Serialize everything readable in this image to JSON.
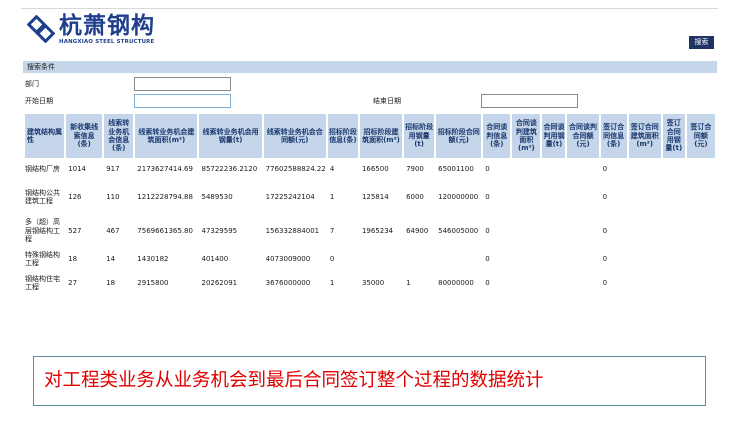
{
  "brand": {
    "name_cn": "杭萧钢构",
    "name_en": "HANGXIAO STEEL STRUCTURE"
  },
  "toolbar": {
    "search_label": "搜索"
  },
  "search_panel": {
    "title": "搜索条件",
    "department_label": "部门",
    "department_value": "",
    "start_date_label": "开始日期",
    "start_date_value": "",
    "end_date_label": "结束日期",
    "end_date_value": ""
  },
  "table": {
    "headers": [
      "建筑结构属性",
      "新收集线索信息(条)",
      "线索转业务机会信息(条)",
      "线索转业务机会建筑面积(m²)",
      "线索转业务机会用钢量(t)",
      "线索转业务机会合同额(元)",
      "招标阶段信息(条)",
      "招标阶段建筑面积(m²)",
      "招标阶段用钢量(t)",
      "招标阶段合同额(元)",
      "合同谈判信息(条)",
      "合同谈判建筑面积(m²)",
      "合同谈判用钢量(t)",
      "合同谈判合同额(元)",
      "签订合同信息(条)",
      "签订合同建筑面积(m²)",
      "签订合同用钢量(t)",
      "签订合同额(元)"
    ],
    "rows": [
      [
        "钢结构厂房",
        "1014",
        "917",
        "2173627414.69",
        "85722236.2120",
        "77602588824.22",
        "4",
        "166500",
        "7900",
        "65001100",
        "0",
        "",
        "",
        "",
        "0",
        "",
        "",
        ""
      ],
      [
        "钢结构公共建筑工程",
        "126",
        "110",
        "1212228794.88",
        "5489530",
        "17225242104",
        "1",
        "125814",
        "6000",
        "120000000",
        "0",
        "",
        "",
        "",
        "0",
        "",
        "",
        ""
      ],
      [
        "多（超）高层钢结构工程",
        "527",
        "467",
        "7569661365.80",
        "47329595",
        "156332884001",
        "7",
        "1965234",
        "64900",
        "546005000",
        "0",
        "",
        "",
        "",
        "0",
        "",
        "",
        ""
      ],
      [
        "特殊钢结构工程",
        "18",
        "14",
        "1430182",
        "401400",
        "4073009000",
        "0",
        "",
        "",
        "",
        "0",
        "",
        "",
        "",
        "0",
        "",
        "",
        ""
      ],
      [
        "钢结构住宅工程",
        "27",
        "18",
        "2915800",
        "20262091",
        "3676000000",
        "1",
        "35000",
        "1",
        "80000000",
        "0",
        "",
        "",
        "",
        "0",
        "",
        "",
        ""
      ]
    ]
  },
  "caption": "对工程类业务从业务机会到最后合同签订整个过程的数据统计",
  "colors": {
    "brand_blue": "#1f3f8c",
    "header_bg": "#c5d5ea",
    "header_text": "#1a3a6e",
    "button_bg": "#1f3464",
    "caption_text": "#e00000",
    "caption_border": "#5a8fa0"
  },
  "icons": {
    "logo": "diamond-chain-logo-icon"
  }
}
